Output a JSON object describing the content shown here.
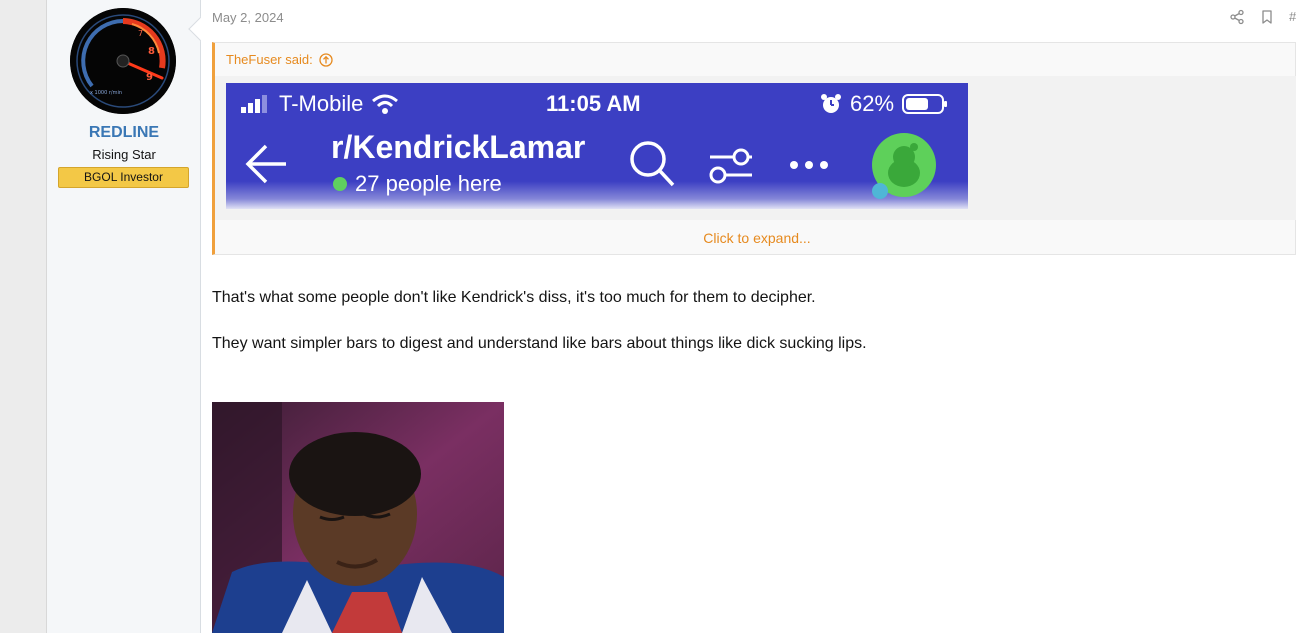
{
  "user": {
    "name": "REDLINE",
    "title": "Rising Star",
    "banner": "BGOL Investor"
  },
  "post": {
    "date": "May 2, 2024",
    "quote": {
      "author_label": "TheFuser said:",
      "expand_label": "Click to expand...",
      "screenshot": {
        "carrier": "T-Mobile",
        "time": "11:05 AM",
        "battery": "62%",
        "subreddit": "r/KendrickLamar",
        "online": "27 people here"
      }
    },
    "paragraphs": [
      "That's what some people don't like Kendrick's diss, it's too much for them to decipher.",
      "They want simpler bars to digest and understand like bars about things like dick sucking lips."
    ]
  },
  "icons": {
    "share": "share-icon",
    "bookmark": "bookmark-icon",
    "jump": "arrow-up-circle-icon"
  },
  "colors": {
    "username": "#3a77b5",
    "quote_accent": "#f0a03c",
    "banner": "#f3c846",
    "reddit_header": "#3c3fc3"
  }
}
